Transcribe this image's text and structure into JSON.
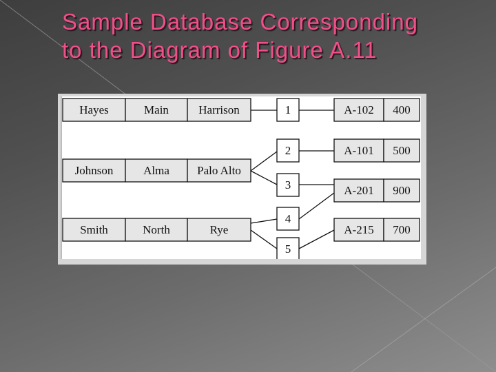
{
  "slide": {
    "title_lines": [
      "Sample Database Corresponding",
      "to the Diagram of Figure A.11"
    ],
    "title_color": "#f0508a"
  },
  "diagram": {
    "customers": [
      {
        "name": "Hayes",
        "street": "Main",
        "city": "Harrison"
      },
      {
        "name": "Johnson",
        "street": "Alma",
        "city": "Palo Alto"
      },
      {
        "name": "Smith",
        "street": "North",
        "city": "Rye"
      }
    ],
    "links": [
      "1",
      "2",
      "3",
      "4",
      "5"
    ],
    "accounts": [
      {
        "number": "A-102",
        "balance": "400"
      },
      {
        "number": "A-101",
        "balance": "500"
      },
      {
        "number": "A-201",
        "balance": "900"
      },
      {
        "number": "A-215",
        "balance": "700"
      }
    ],
    "connections": [
      {
        "customer": "Hayes",
        "link": "1",
        "account": "A-102"
      },
      {
        "customer": "Johnson",
        "link": "2",
        "account": "A-101"
      },
      {
        "customer": "Johnson",
        "link": "3",
        "account": "A-201"
      },
      {
        "customer": "Smith",
        "link": "4",
        "account": "A-201"
      },
      {
        "customer": "Smith",
        "link": "5",
        "account": "A-215"
      }
    ]
  }
}
